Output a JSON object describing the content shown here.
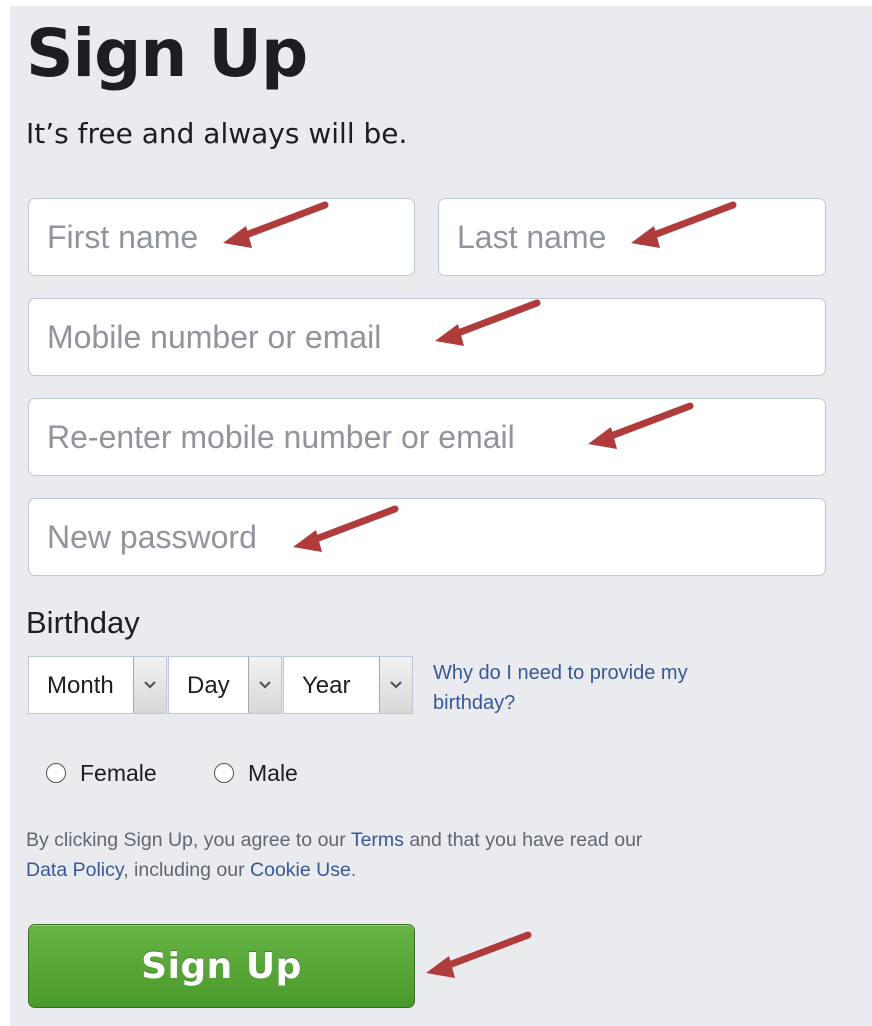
{
  "header": {
    "title": "Sign Up",
    "subtitle": "It’s free and always will be."
  },
  "form": {
    "first_name_placeholder": "First name",
    "last_name_placeholder": "Last name",
    "mobile_placeholder": "Mobile number or email",
    "reenter_placeholder": "Re-enter mobile number or email",
    "password_placeholder": "New password"
  },
  "birthday": {
    "label": "Birthday",
    "month": "Month",
    "day": "Day",
    "year": "Year",
    "why_link": "Why do I need to provide my birthday?"
  },
  "gender": {
    "female": "Female",
    "male": "Male"
  },
  "legal": {
    "part1": "By clicking Sign Up, you agree to our ",
    "terms": "Terms",
    "part2": " and that you have read our ",
    "data_policy": "Data Policy",
    "part3": ", including our ",
    "cookie_use": "Cookie Use",
    "part4": "."
  },
  "submit": {
    "label": "Sign Up"
  },
  "colors": {
    "panel_bg": "#e9ebee",
    "link": "#385898",
    "button_green": "#58a738",
    "annotation_arrow": "#b03b3b"
  }
}
